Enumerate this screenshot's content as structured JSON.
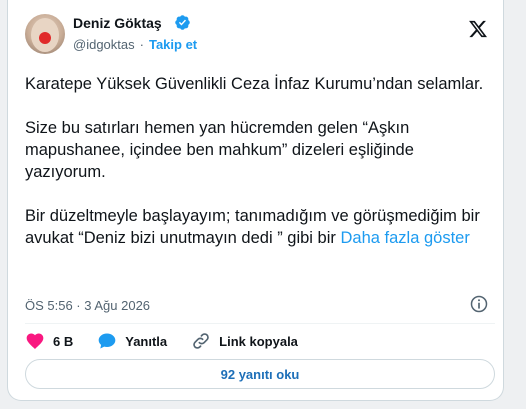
{
  "author": {
    "name": "Deniz Göktaş",
    "handle": "@idgoktas",
    "separator": "·",
    "follow_label": "Takip et"
  },
  "tweet": {
    "paragraphs": [
      "Karatepe Yüksek Güvenlikli Ceza İnfaz Kurumu’ndan selamlar.",
      "Size bu satırları hemen yan hücremden gelen “Aşkın mapushanee, içindee ben mahkum”  dizeleri eşliğinde yazıyorum.",
      "Bir düzeltmeyle başlayayım; tanımadığım ve görüşmediğim bir avukat “Deniz bizi unutmayın dedi ” gibi bir"
    ],
    "show_more_label": "Daha fazla göster",
    "timestamp": "ÖS 5:56 · 3 Ağu 2026"
  },
  "actions": {
    "like_count": "6 B",
    "reply_label": "Yanıtla",
    "copy_link_label": "Link kopyala"
  },
  "replies_button_label": "92 yanıtı oku",
  "colors": {
    "accent": "#1d9bf0",
    "like": "#f91880",
    "text": "#0f1419",
    "muted": "#536471"
  },
  "icons": [
    "verified-badge-icon",
    "x-logo-icon",
    "info-icon",
    "heart-icon",
    "reply-bubble-icon",
    "link-icon"
  ]
}
